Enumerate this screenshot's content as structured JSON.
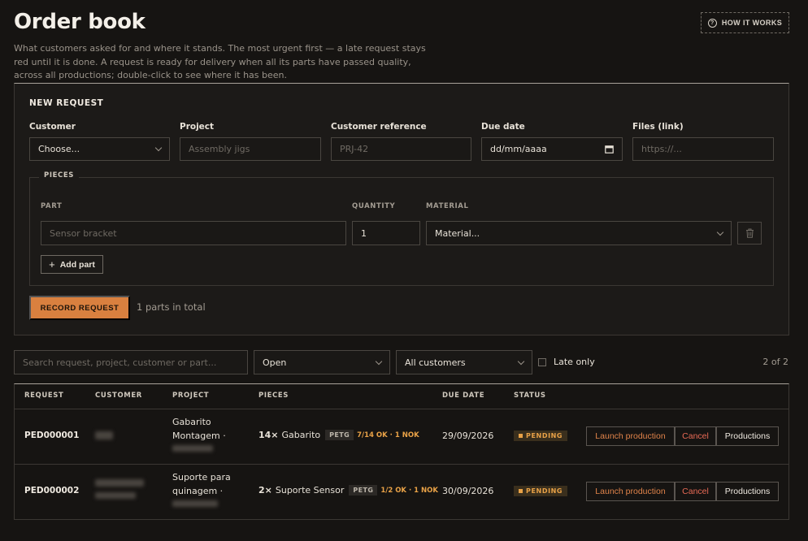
{
  "header": {
    "title": "Order book",
    "intro": "What customers asked for and where it stands. The most urgent first — a late request stays red until it is done. A request is ready for delivery when all its parts have passed quality, across all productions; double-click to see where it has been.",
    "how_it_works": "HOW IT WORKS"
  },
  "new_request": {
    "title": "NEW REQUEST",
    "customer": {
      "label": "Customer",
      "value": "Choose..."
    },
    "project": {
      "label": "Project",
      "placeholder": "Assembly jigs"
    },
    "customer_reference": {
      "label": "Customer reference",
      "placeholder": "PRJ-42"
    },
    "due_date": {
      "label": "Due date",
      "value": "dd/mm/aaaa"
    },
    "files": {
      "label": "Files (link)",
      "placeholder": "https://..."
    },
    "pieces": {
      "legend": "PIECES",
      "col_part": "PART",
      "col_quantity": "QUANTITY",
      "col_material": "MATERIAL",
      "part_placeholder": "Sensor bracket",
      "quantity_value": "1",
      "material_value": "Material...",
      "add_part": "Add part"
    },
    "record_button": "RECORD REQUEST",
    "parts_total": "1 parts in total"
  },
  "filters": {
    "search_placeholder": "Search request, project, customer or part...",
    "status_value": "Open",
    "customer_value": "All customers",
    "late_only_label": "Late only",
    "count": "2 of 2"
  },
  "table": {
    "headers": {
      "request": "REQUEST",
      "customer": "CUSTOMER",
      "project": "PROJECT",
      "pieces": "PIECES",
      "due_date": "DUE DATE",
      "status": "STATUS"
    },
    "rows": [
      {
        "id": "PED000001",
        "project_line1": "Gabarito",
        "project_line2": "Montagem ·",
        "qty": "14×",
        "part": "Gabarito",
        "material": "PETG",
        "qc": "7/14 OK · 1 NOK",
        "due": "29/09/2026",
        "status": "PENDING",
        "launch": "Launch production",
        "cancel": "Cancel",
        "productions": "Productions"
      },
      {
        "id": "PED000002",
        "project_line1": "Suporte para",
        "project_line2": "quinagem ·",
        "qty": "2×",
        "part": "Suporte Sensor",
        "material": "PETG",
        "qc": "1/2 OK · 1 NOK",
        "due": "30/09/2026",
        "status": "PENDING",
        "launch": "Launch production",
        "cancel": "Cancel",
        "productions": "Productions"
      }
    ]
  },
  "colors": {
    "accent": "#d9803f",
    "pending": "#e9a247",
    "cancel": "#e86a55",
    "background": "#161412"
  }
}
